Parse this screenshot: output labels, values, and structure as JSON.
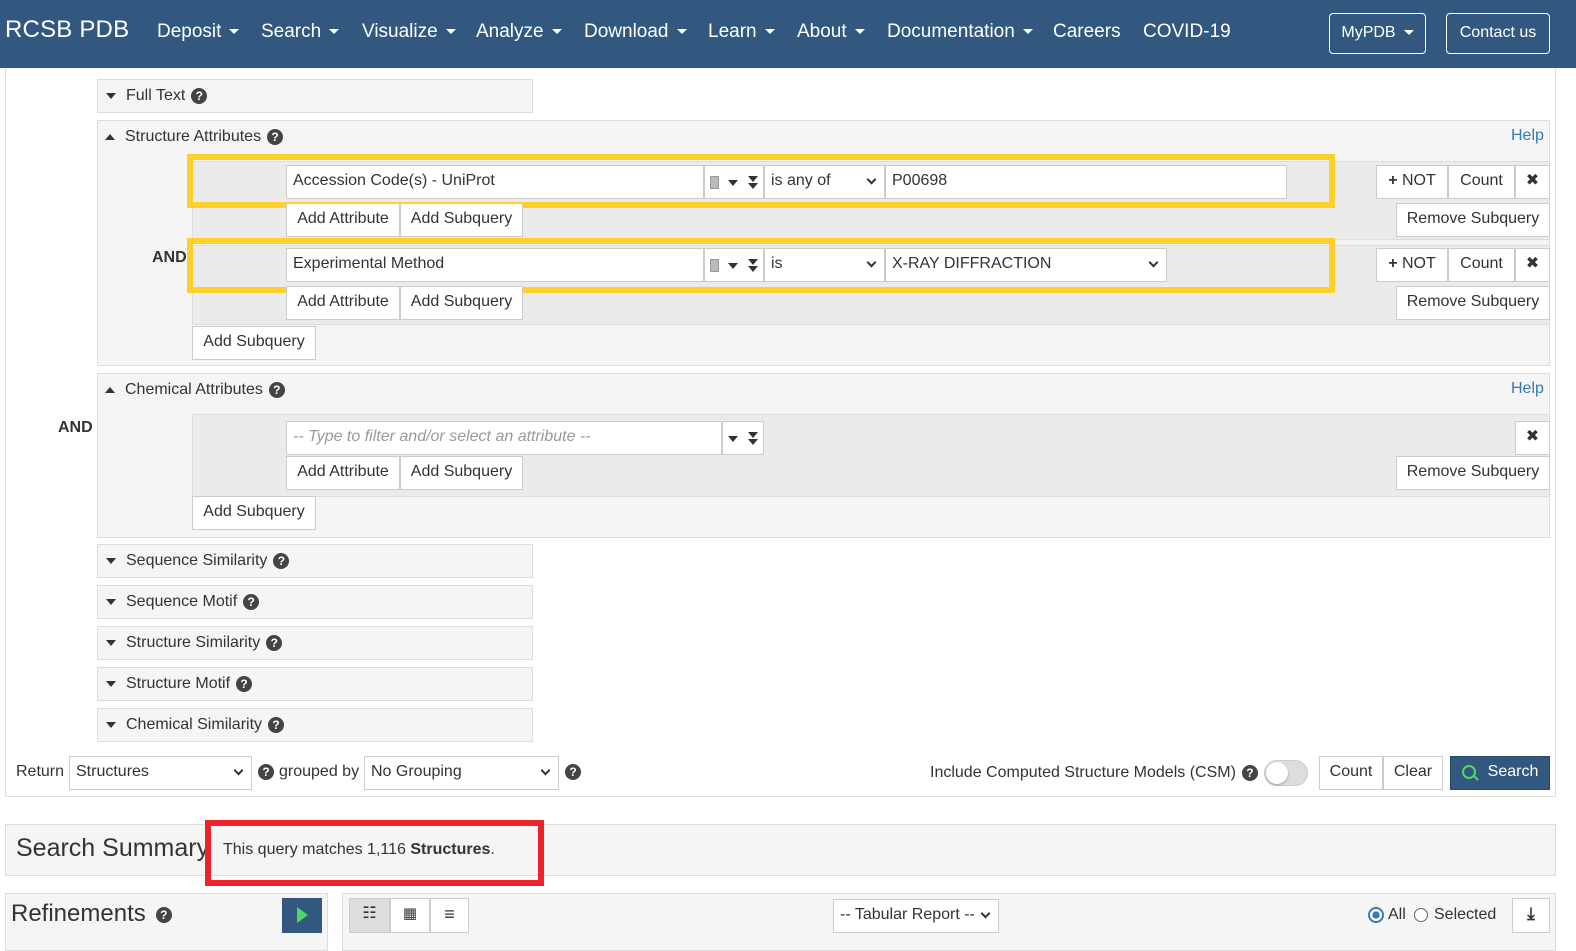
{
  "nav": {
    "brand": "RCSB PDB",
    "items": [
      "Deposit",
      "Search",
      "Visualize",
      "Analyze",
      "Download",
      "Learn",
      "About",
      "Documentation",
      "Careers",
      "COVID-19"
    ],
    "mypdb": "MyPDB",
    "contact": "Contact us"
  },
  "groups": {
    "full_text": "Full Text",
    "structure_attributes": "Structure Attributes",
    "chemical_attributes": "Chemical Attributes",
    "sequence_similarity": "Sequence Similarity",
    "sequence_motif": "Sequence Motif",
    "structure_similarity": "Structure Similarity",
    "structure_motif": "Structure Motif",
    "chemical_similarity": "Chemical Similarity",
    "help": "Help",
    "and": "AND"
  },
  "rows": {
    "row1": {
      "attribute": "Accession Code(s) - UniProt",
      "operator": "is any of",
      "value": "P00698"
    },
    "row2": {
      "attribute": "Experimental Method",
      "operator": "is",
      "value": "X-RAY DIFFRACTION"
    },
    "chem_placeholder": "-- Type to filter and/or select an attribute --"
  },
  "buttons": {
    "not": "NOT",
    "count": "Count",
    "add_attribute": "Add Attribute",
    "add_subquery": "Add Subquery",
    "remove_subquery": "Remove Subquery",
    "clear": "Clear",
    "search": "Search"
  },
  "footer": {
    "return_label": "Return",
    "return_value": "Structures",
    "grouped_by": "grouped by",
    "grouping_value": "No Grouping",
    "csm_label": "Include Computed Structure Models (CSM)"
  },
  "summary": {
    "title": "Search Summary",
    "text_prefix": "This query matches 1,116 ",
    "text_bold": "Structures",
    "text_suffix": "."
  },
  "results": {
    "refinements": "Refinements",
    "report": "-- Tabular Report --",
    "all": "All",
    "selected": "Selected"
  },
  "colors": {
    "navbar": "#325880",
    "highlight_yellow": "#fdd02c",
    "highlight_red": "#ee2229",
    "link": "#337ab7"
  }
}
